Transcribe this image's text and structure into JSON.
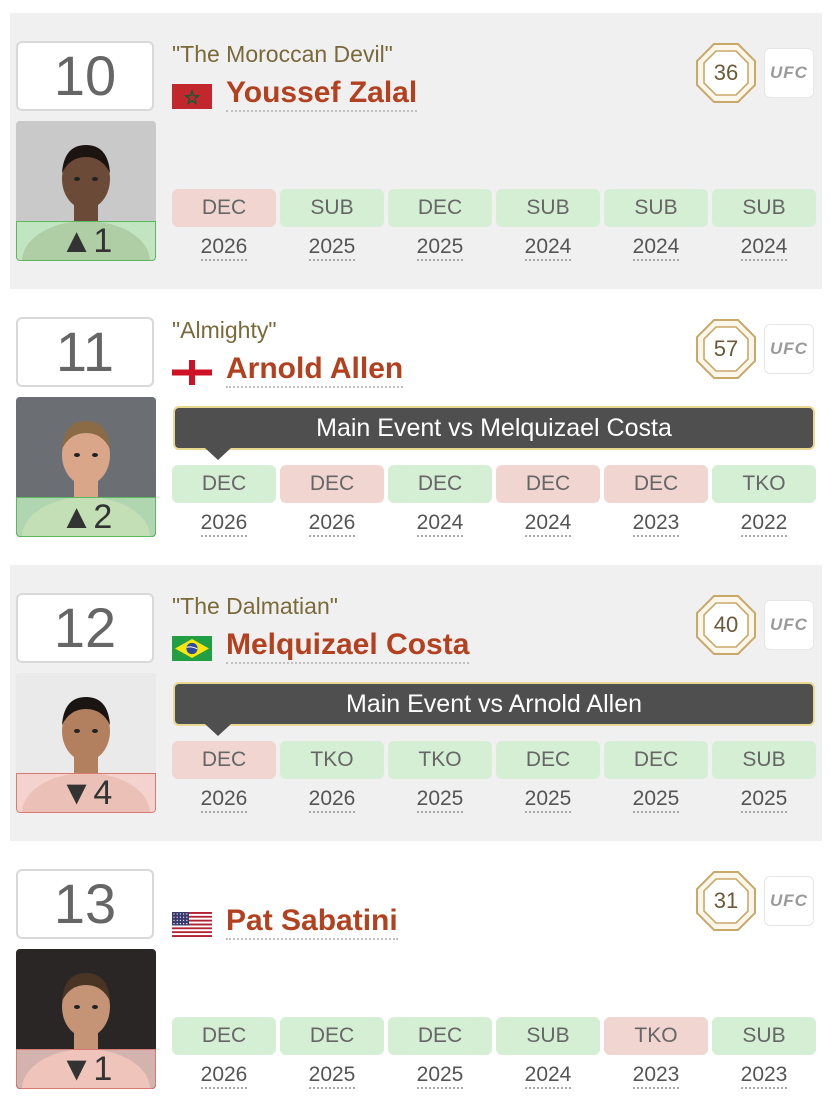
{
  "fighters": [
    {
      "rank": "10",
      "nickname": "\"The Moroccan Devil\"",
      "name": "Youssef Zalal",
      "flag": "morocco-flag",
      "rank_change": "▲1",
      "rank_change_direction": "up",
      "score": "36",
      "org_label": "UFC",
      "tooltip": "",
      "fights": [
        {
          "method": "DEC",
          "year": "2026",
          "result": "loss"
        },
        {
          "method": "SUB",
          "year": "2025",
          "result": "win"
        },
        {
          "method": "DEC",
          "year": "2025",
          "result": "win"
        },
        {
          "method": "SUB",
          "year": "2024",
          "result": "win"
        },
        {
          "method": "SUB",
          "year": "2024",
          "result": "win"
        },
        {
          "method": "SUB",
          "year": "2024",
          "result": "win"
        }
      ]
    },
    {
      "rank": "11",
      "nickname": "\"Almighty\"",
      "name": "Arnold Allen",
      "flag": "england-flag",
      "rank_change": "▲2",
      "rank_change_direction": "up",
      "score": "57",
      "org_label": "UFC",
      "tooltip": "Main Event vs Melquizael Costa",
      "fights": [
        {
          "method": "DEC",
          "year": "2026",
          "result": "win"
        },
        {
          "method": "DEC",
          "year": "2026",
          "result": "loss"
        },
        {
          "method": "DEC",
          "year": "2024",
          "result": "win"
        },
        {
          "method": "DEC",
          "year": "2024",
          "result": "loss"
        },
        {
          "method": "DEC",
          "year": "2023",
          "result": "loss"
        },
        {
          "method": "TKO",
          "year": "2022",
          "result": "win"
        }
      ]
    },
    {
      "rank": "12",
      "nickname": "\"The Dalmatian\"",
      "name": "Melquizael Costa",
      "flag": "brazil-flag",
      "rank_change": "▼4",
      "rank_change_direction": "down",
      "score": "40",
      "org_label": "UFC",
      "tooltip": "Main Event vs Arnold Allen",
      "fights": [
        {
          "method": "DEC",
          "year": "2026",
          "result": "loss"
        },
        {
          "method": "TKO",
          "year": "2026",
          "result": "win"
        },
        {
          "method": "TKO",
          "year": "2025",
          "result": "win"
        },
        {
          "method": "DEC",
          "year": "2025",
          "result": "win"
        },
        {
          "method": "DEC",
          "year": "2025",
          "result": "win"
        },
        {
          "method": "SUB",
          "year": "2025",
          "result": "win"
        }
      ]
    },
    {
      "rank": "13",
      "nickname": "",
      "name": "Pat Sabatini",
      "flag": "usa-flag",
      "rank_change": "▼1",
      "rank_change_direction": "down",
      "score": "31",
      "org_label": "UFC",
      "tooltip": "",
      "fights": [
        {
          "method": "DEC",
          "year": "2026",
          "result": "win"
        },
        {
          "method": "DEC",
          "year": "2025",
          "result": "win"
        },
        {
          "method": "DEC",
          "year": "2025",
          "result": "win"
        },
        {
          "method": "SUB",
          "year": "2024",
          "result": "win"
        },
        {
          "method": "TKO",
          "year": "2023",
          "result": "loss"
        },
        {
          "method": "SUB",
          "year": "2023",
          "result": "win"
        }
      ]
    }
  ]
}
